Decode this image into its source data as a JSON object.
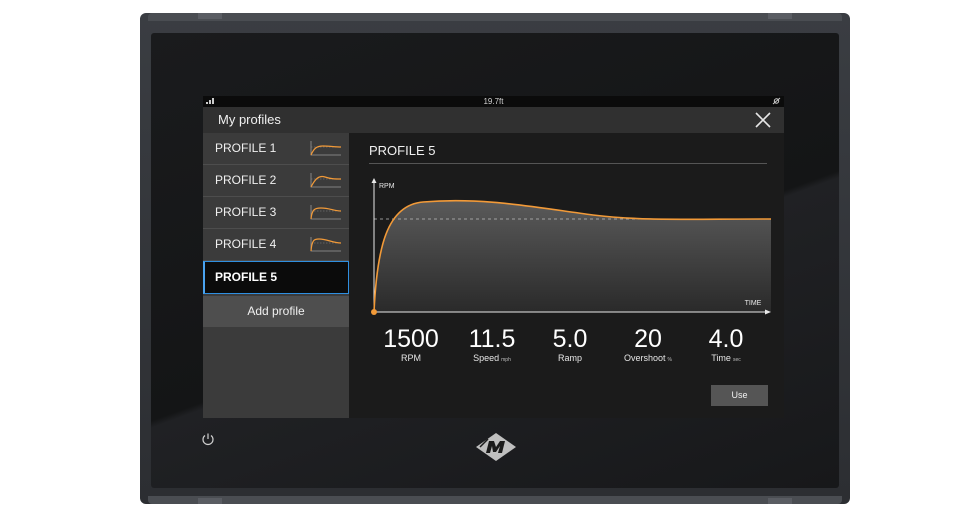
{
  "status_bar": {
    "signal_icon": "signal-icon",
    "depth": "19.7ft",
    "satellite_icon": "satellite-icon"
  },
  "dialog": {
    "title": "My profiles",
    "close_icon": "close-icon"
  },
  "sidebar": {
    "items": [
      {
        "label": "PROFILE 1"
      },
      {
        "label": "PROFILE 2"
      },
      {
        "label": "PROFILE 3"
      },
      {
        "label": "PROFILE 4"
      },
      {
        "label": "PROFILE 5",
        "active": true
      }
    ],
    "add_label": "Add profile"
  },
  "detail": {
    "heading": "PROFILE 5",
    "chart_ylabel": "RPM",
    "chart_xlabel": "TIME"
  },
  "readouts": [
    {
      "value": "1500",
      "label": "RPM",
      "unit": ""
    },
    {
      "value": "11.5",
      "label": "Speed",
      "unit": "mph"
    },
    {
      "value": "5.0",
      "label": "Ramp",
      "unit": ""
    },
    {
      "value": "20",
      "label": "Overshoot",
      "unit": "%"
    },
    {
      "value": "4.0",
      "label": "Time",
      "unit": "sec"
    }
  ],
  "use_label": "Use",
  "colors": {
    "accent": "#f29a38",
    "active_border": "#2f8fe0"
  },
  "icons": {
    "power": "power-icon",
    "brand": "mercury-logo"
  }
}
